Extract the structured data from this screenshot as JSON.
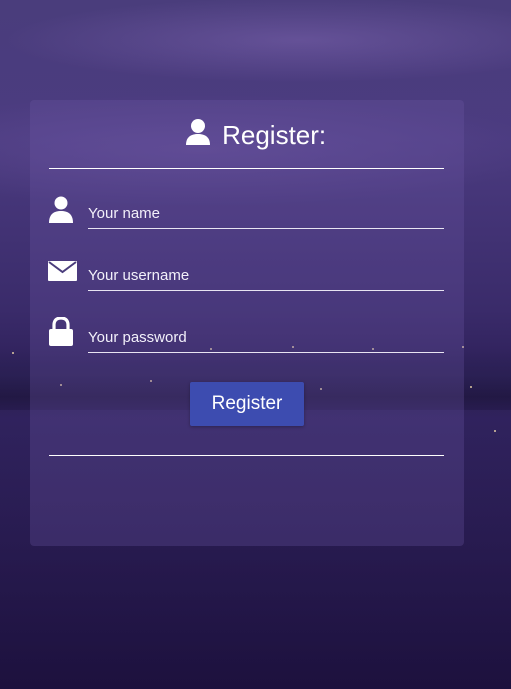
{
  "form": {
    "title": "Register:",
    "fields": [
      {
        "icon": "user-icon",
        "placeholder": "Your name"
      },
      {
        "icon": "envelope-icon",
        "placeholder": "Your username"
      },
      {
        "icon": "lock-icon",
        "placeholder": "Your password"
      }
    ],
    "submit_label": "Register"
  },
  "colors": {
    "button": "#3d4cb0",
    "text": "#ffffff",
    "background": "#3a2b6a"
  }
}
